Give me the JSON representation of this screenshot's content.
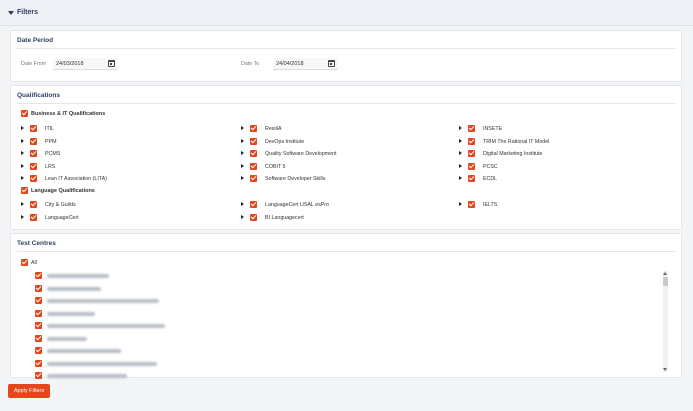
{
  "header": {
    "title": "Filters"
  },
  "date_period": {
    "title": "Date Period",
    "from_label": "Date From",
    "from_value": "24/03/2018",
    "to_label": "Date To",
    "to_value": "24/04/2018"
  },
  "qualifications": {
    "title": "Qualifications",
    "business_group": "Business & IT Qualifications",
    "col1": [
      "ITIL",
      "PPM",
      "PCMS",
      "LRS",
      "Lean IT Association (LITA)"
    ],
    "col2": [
      "ResiliA",
      "DevOps Institute",
      "Quality Software Development",
      "COBIT 5",
      "Software Developer Skills"
    ],
    "col3": [
      "INSETE",
      "TRIM The Rational IT Model",
      "Digital Marketing Institute",
      "PCSC",
      "ECDL"
    ],
    "language_group": "Language Qualifications",
    "lang_col1": [
      "City & Guilds",
      "LanguageCert"
    ],
    "lang_col2": [
      "LanguageCert USAL esPro",
      "BI Languagecert"
    ],
    "lang_col3": [
      "IELTS"
    ]
  },
  "test_centres": {
    "title": "Test Centres",
    "all_label": "All"
  },
  "footer": {
    "apply_label": "Apply Filters"
  },
  "colors": {
    "accent": "#e2481c",
    "heading": "#2f3f63"
  },
  "icons": {
    "collapse": "triangle-down-icon",
    "calendar": "calendar-icon",
    "expand": "chevron-right-icon",
    "checkbox": "checkbox-checked-icon"
  }
}
